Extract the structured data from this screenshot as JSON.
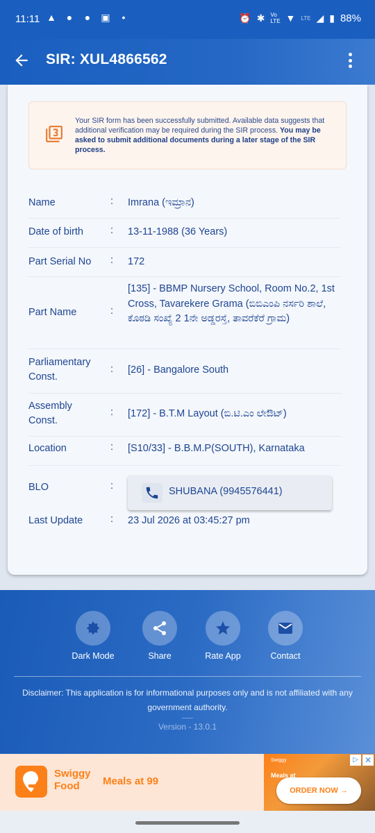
{
  "status_bar": {
    "time": "11:11",
    "battery": "88%",
    "network_label": "LTE"
  },
  "app_bar": {
    "title": "SIR: XUL4866562"
  },
  "notice": {
    "text_normal": "Your SIR form has been successfully submitted. Available data suggests that additional verification may be required during the SIR process.",
    "text_bold": "You may be asked to submit additional documents during a later stage of the SIR process."
  },
  "details": [
    {
      "label": "Name",
      "value": "Imrana (ಇಮ್ರಾನ)"
    },
    {
      "label": "Date of birth",
      "value": "13-11-1988 (36 Years)"
    },
    {
      "label": "Part Serial No",
      "value": "172"
    },
    {
      "label": "Part Name",
      "value": "[135] - BBMP Nursery School, Room No.2, 1st Cross, Tavarekere Grama (ಬಿಬಿಎಂಪಿ ನರ್ಸರಿ ಶಾಲೆ, ಕೊಠಡಿ ಸಂಖ್ಯೆ 2 1ನೇ ಅಡ್ಡರಸ್ತೆ, ತಾವರೆಕೆರೆ ಗ್ರಾಮ)"
    },
    {
      "label": "Parliamentary Const.",
      "value": "[26] - Bangalore South"
    },
    {
      "label": "Assembly Const.",
      "value": "[172] - B.T.M Layout (ಬಿ.ಟಿ.ಎಂ ಲೇಔಟ್)"
    },
    {
      "label": "Location",
      "value": "[S10/33] - B.B.M.P(SOUTH), Karnataka"
    },
    {
      "label": "BLO",
      "value": "SHUBANA (9945576441)"
    },
    {
      "label": "Last Update",
      "value": "23 Jul 2026 at 03:45:27 pm"
    }
  ],
  "separator": ":",
  "footer": {
    "buttons": [
      {
        "label": "Dark Mode",
        "icon": "dark-mode-icon"
      },
      {
        "label": "Share",
        "icon": "share-icon"
      },
      {
        "label": "Rate App",
        "icon": "star-icon"
      },
      {
        "label": "Contact",
        "icon": "mail-icon"
      }
    ],
    "disclaimer": "Disclaimer: This application is for informational purposes only and is not affiliated with any government authority.",
    "version": "Version - 13.0.1"
  },
  "ad": {
    "brand_line1": "Swiggy",
    "brand_line2": "Food",
    "tagline": "Meals at 99",
    "image_brand": "Swiggy",
    "image_headline": "Meals at",
    "cta": "ORDER NOW →"
  },
  "colors": {
    "primary": "#1a5fc0",
    "text": "#1e4593",
    "ad_accent": "#fc8019"
  }
}
